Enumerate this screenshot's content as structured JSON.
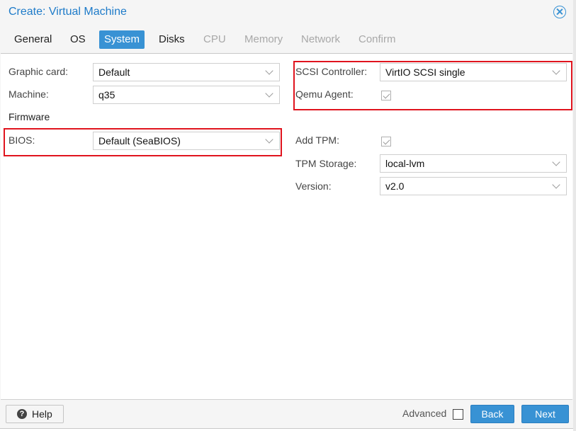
{
  "dialog": {
    "title": "Create: Virtual Machine"
  },
  "tabs": [
    {
      "label": "General",
      "state": "normal"
    },
    {
      "label": "OS",
      "state": "normal"
    },
    {
      "label": "System",
      "state": "active"
    },
    {
      "label": "Disks",
      "state": "normal"
    },
    {
      "label": "CPU",
      "state": "disabled"
    },
    {
      "label": "Memory",
      "state": "disabled"
    },
    {
      "label": "Network",
      "state": "disabled"
    },
    {
      "label": "Confirm",
      "state": "disabled"
    }
  ],
  "left": {
    "graphic_card": {
      "label": "Graphic card:",
      "value": "Default"
    },
    "machine": {
      "label": "Machine:",
      "value": "q35"
    },
    "firmware_header": "Firmware",
    "bios": {
      "label": "BIOS:",
      "value": "Default (SeaBIOS)"
    }
  },
  "right": {
    "scsi_controller": {
      "label": "SCSI Controller:",
      "value": "VirtIO SCSI single"
    },
    "qemu_agent": {
      "label": "Qemu Agent:",
      "checked": true
    },
    "add_tpm": {
      "label": "Add TPM:",
      "checked": true
    },
    "tpm_storage": {
      "label": "TPM Storage:",
      "value": "local-lvm"
    },
    "version": {
      "label": "Version:",
      "value": "v2.0"
    }
  },
  "footer": {
    "help": "Help",
    "advanced": "Advanced",
    "advanced_checked": false,
    "back": "Back",
    "next": "Next"
  },
  "colors": {
    "accent": "#3892d4",
    "title": "#1e7bc9",
    "highlight": "#e0141e"
  }
}
